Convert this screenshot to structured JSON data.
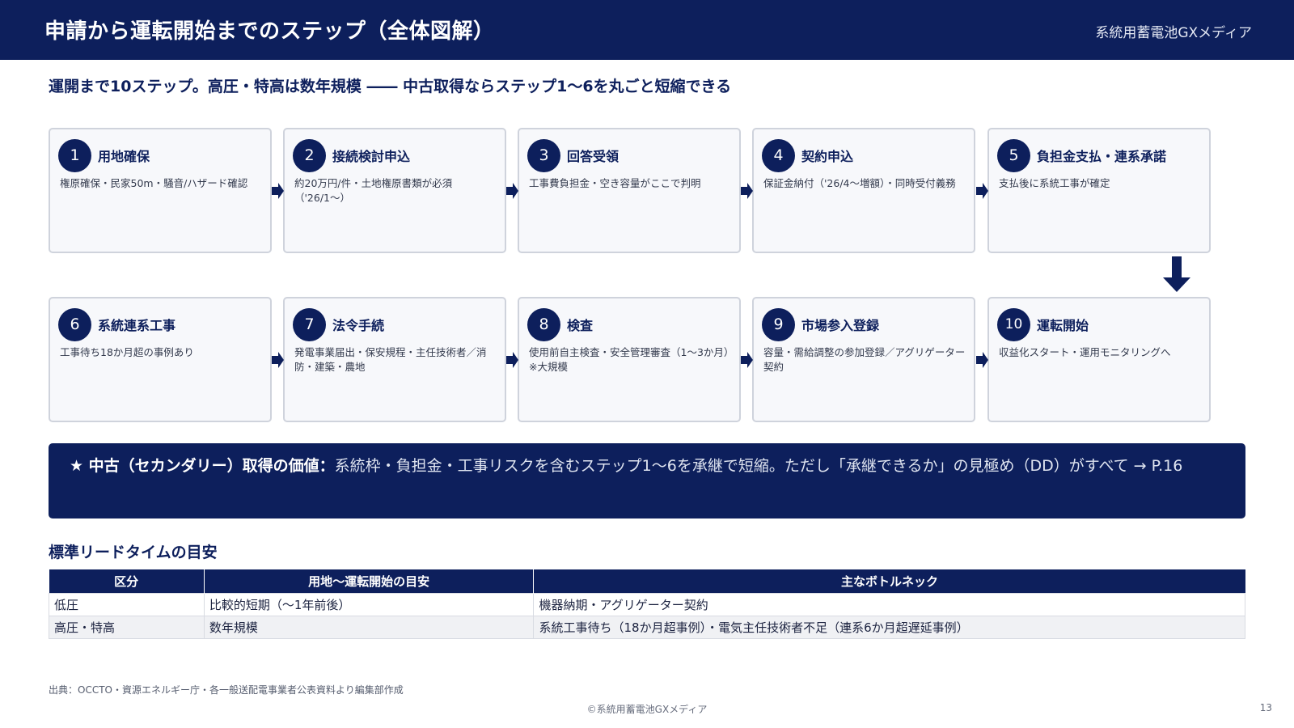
{
  "header": {
    "title": "申請から運転開始までのステップ（全体図解）",
    "brand": "系統用蓄電池GXメディア"
  },
  "subtitle": "運開まで10ステップ。高圧・特高は数年規模 ―― 中古取得ならステップ1〜6を丸ごと短縮できる",
  "steps": [
    {
      "num": "1",
      "title": "用地確保",
      "desc": "権原確保・民家50m・騒音/ハザード確認"
    },
    {
      "num": "2",
      "title": "接続検討申込",
      "desc": "約20万円/件・土地権原書類が必須（'26/1〜）"
    },
    {
      "num": "3",
      "title": "回答受領",
      "desc": "工事費負担金・空き容量がここで判明"
    },
    {
      "num": "4",
      "title": "契約申込",
      "desc": "保証金納付（'26/4〜増額）・同時受付義務"
    },
    {
      "num": "5",
      "title": "負担金支払・連系承諾",
      "desc": "支払後に系統工事が確定"
    },
    {
      "num": "6",
      "title": "系統連系工事",
      "desc": "工事待ち18か月超の事例あり"
    },
    {
      "num": "7",
      "title": "法令手続",
      "desc": "発電事業届出・保安規程・主任技術者／消防・建築・農地"
    },
    {
      "num": "8",
      "title": "検査",
      "desc": "使用前自主検査・安全管理審査（1〜3か月）※大規模"
    },
    {
      "num": "9",
      "title": "市場参入登録",
      "desc": "容量・需給調整の参加登録／アグリゲーター契約"
    },
    {
      "num": "10",
      "title": "運転開始",
      "desc": "収益化スタート・運用モニタリングへ"
    }
  ],
  "callout": {
    "label": "★ 中古（セカンダリー）取得の価値：",
    "text": "系統枠・負担金・工事リスクを含むステップ1〜6を承継で短縮。ただし「承継できるか」の見極め（DD）がすべて → P.16"
  },
  "lead_time": {
    "title": "標準リードタイムの目安",
    "headers": [
      "区分",
      "用地〜運転開始の目安",
      "主なボトルネック"
    ],
    "rows": [
      [
        "低圧",
        "比較的短期（〜1年前後）",
        "機器納期・アグリゲーター契約"
      ],
      [
        "高圧・特高",
        "数年規模",
        "系統工事待ち（18か月超事例）・電気主任技術者不足（連系6か月超遅延事例）"
      ]
    ]
  },
  "footer": {
    "source": "出典：OCCTO・資源エネルギー庁・各一般送配電事業者公表資料より編集部作成",
    "copyright": "©系統用蓄電池GXメディア",
    "page": "13"
  },
  "colors": {
    "navy": "#0d1f5c",
    "card_bg": "#f7f8fb",
    "card_border": "#cfd3dc"
  }
}
